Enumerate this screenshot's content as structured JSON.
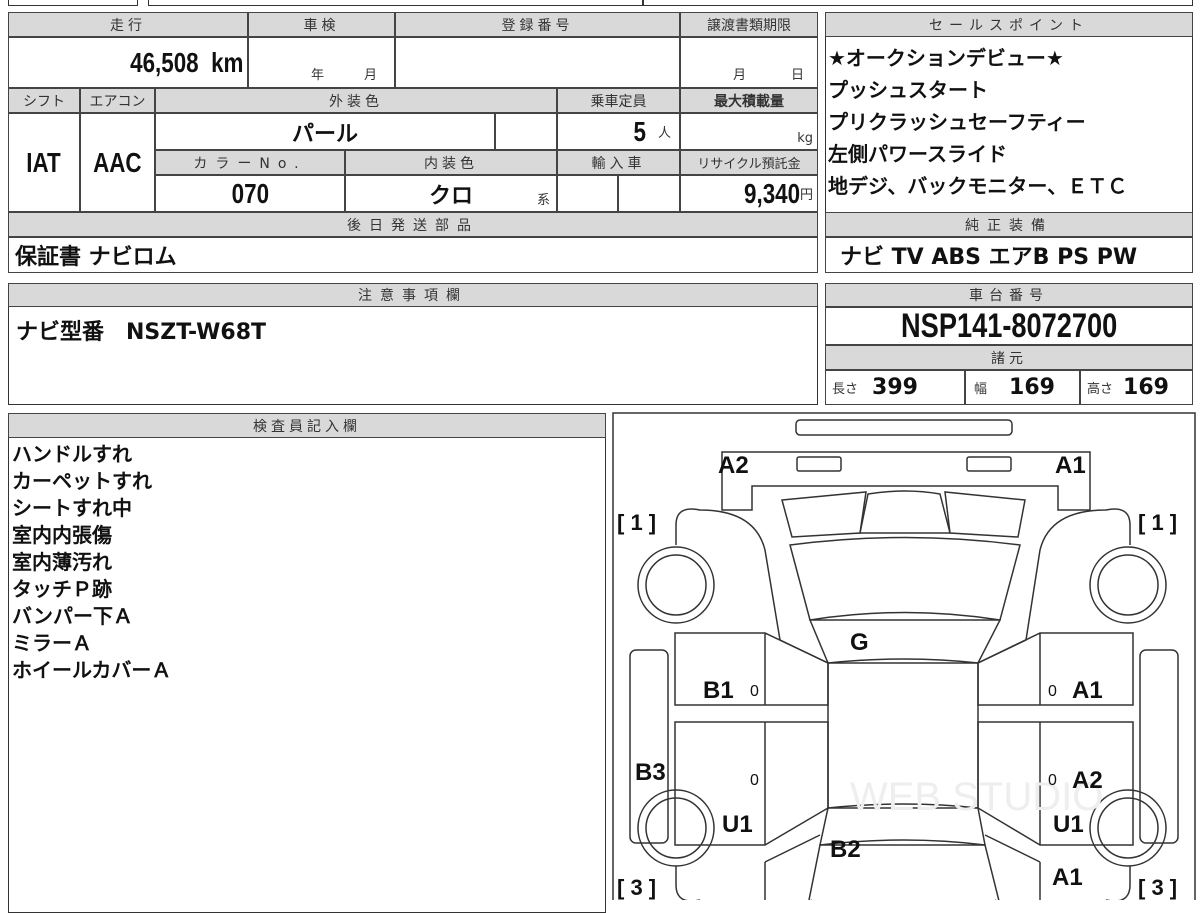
{
  "main": {
    "mileage_label": "走行",
    "mileage": "46,508",
    "mileage_unit": "km",
    "inspection_label": "車検",
    "inspection_year": "年",
    "inspection_month": "月",
    "reg_label": "登録番号",
    "transfer_label": "譲渡書類期限",
    "transfer_month": "月",
    "transfer_day": "日",
    "shift_label": "シフト",
    "ac_label": "エアコン",
    "ext_color_label": "外装色",
    "capacity_label": "乗車定員",
    "max_load_label": "最大積載量",
    "shift": "IAT",
    "ac": "AAC",
    "ext_color": "パール",
    "capacity": "5",
    "capacity_unit": "人",
    "max_load_unit": "kg",
    "color_no_label": "カラーNo.",
    "int_color_label": "内装色",
    "import_label": "輸入車",
    "recycle_label": "リサイクル預託金",
    "color_no": "070",
    "int_color": "クロ",
    "int_color_suffix": "系",
    "recycle": "9,340",
    "recycle_unit": "円",
    "later_parts_label": "後日発送部品",
    "later_parts": "保証書 ナビロム"
  },
  "sales": {
    "label": "セールスポイント",
    "items": [
      "★オークションデビュー★",
      "プッシュスタート",
      "プリクラッシュセーフティー",
      "左側パワースライド",
      "地デジ、バックモニター、ＥＴＣ"
    ]
  },
  "equipment": {
    "label": "純正装備",
    "value": "ナビ TV ABS エアB PS PW"
  },
  "notes": {
    "label": "注意事項欄",
    "value": "ナビ型番　NSZT-W68T"
  },
  "chassis": {
    "label": "車台番号",
    "value": "NSP141-8072700",
    "spec_label": "諸元",
    "length_label": "長さ",
    "length": "399",
    "width_label": "幅",
    "width": "169",
    "height_label": "高さ",
    "height": "169"
  },
  "inspector": {
    "label": "検査員記入欄",
    "items": [
      "ハンドルすれ",
      "カーペットすれ",
      "シートすれ中",
      "室内内張傷",
      "室内薄汚れ",
      "タッチＰ跡",
      "バンパー下Ａ",
      "ミラーＡ",
      "ホイールカバーＡ"
    ]
  },
  "diagram": {
    "marks": {
      "front_left": "A2",
      "front_right": "A1",
      "hood": "G",
      "left_front_door": "B1",
      "right_front_door": "A1",
      "left_rail": "B3",
      "right_rear_door": "A2",
      "left_rear": "U1",
      "right_rear": "U1",
      "trunk": "B2",
      "right_rear_quarter": "A1",
      "front_left_wheel": "[ 1 ]",
      "front_right_wheel": "[ 1 ]",
      "rear_left_wheel": "[ 3 ]",
      "rear_right_wheel": "[ 3 ]",
      "door_handle": "0"
    },
    "watermark": "WEB STUDIO"
  }
}
